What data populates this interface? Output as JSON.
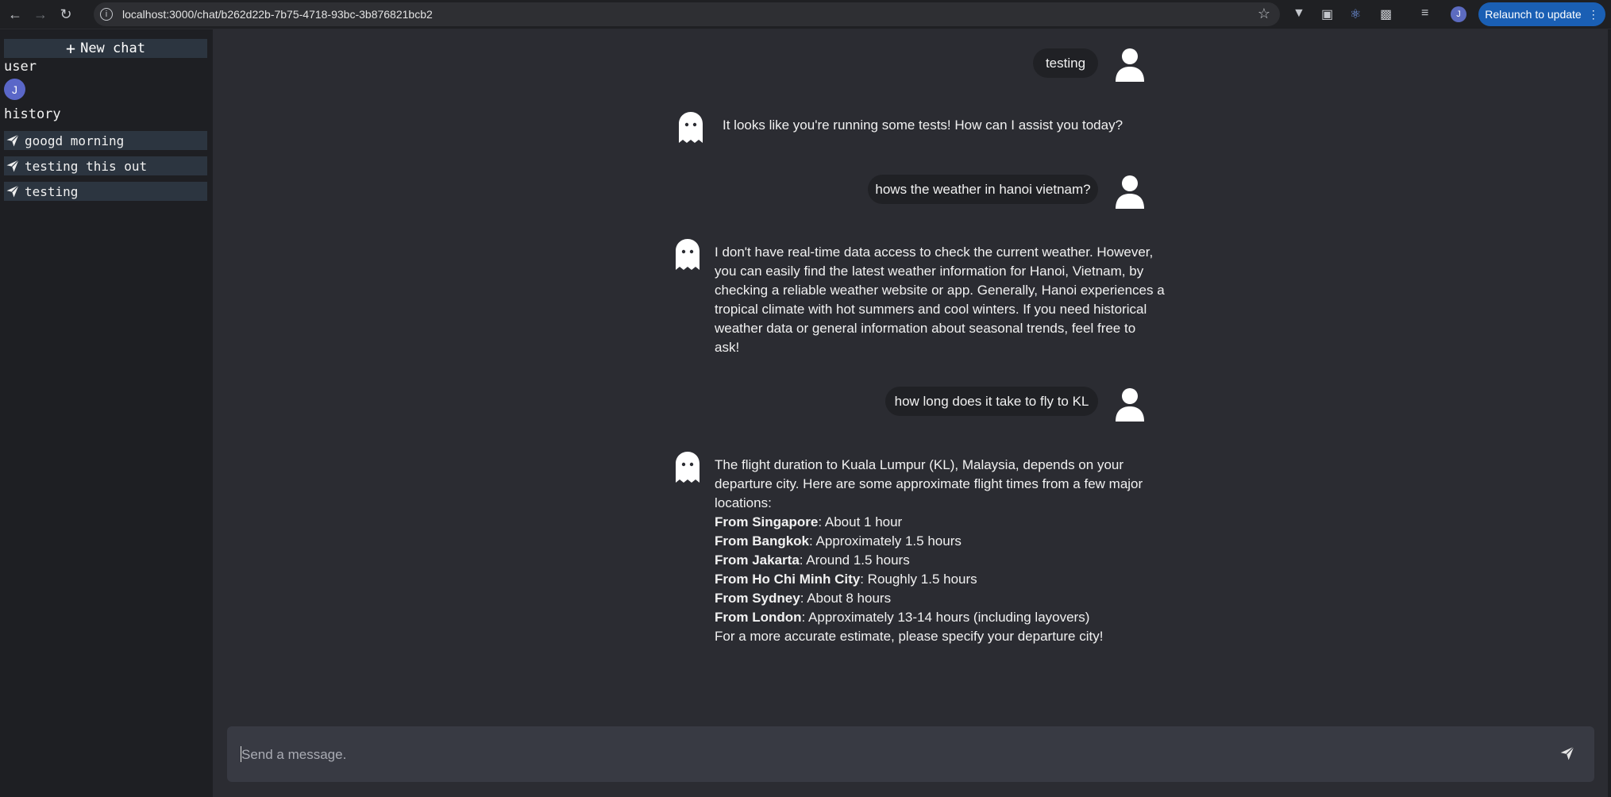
{
  "browser": {
    "url": "localhost:3000/chat/b262d22b-7b75-4718-93bc-3b876821bcb2",
    "profile_initial": "J",
    "relaunch_label": "Relaunch to update"
  },
  "sidebar": {
    "new_chat_label": "New chat",
    "user_label": "user",
    "avatar_initial": "J",
    "history_label": "history",
    "history_items": [
      {
        "label": "googd morning"
      },
      {
        "label": "testing this out"
      },
      {
        "label": "testing"
      }
    ]
  },
  "chat": {
    "messages": [
      {
        "role": "user",
        "text": "testing"
      },
      {
        "role": "bot",
        "text": "It looks like you're running some tests! How can I assist you today?"
      },
      {
        "role": "user",
        "text": "hows the weather in hanoi vietnam?"
      },
      {
        "role": "bot",
        "lines": [
          "I don't have real-time data access to check the current weather. However,",
          "you can easily find the latest weather information for Hanoi, Vietnam, by",
          "checking a reliable weather website or app. Generally, Hanoi experiences a",
          "tropical climate with hot summers and cool winters. If you need historical",
          "weather data or general information about seasonal trends, feel free to",
          "ask!"
        ]
      },
      {
        "role": "user",
        "text": "how long does it take to fly to KL"
      },
      {
        "role": "bot",
        "intro": [
          "The flight duration to Kuala Lumpur (KL), Malaysia, depends on your",
          "departure city. Here are some approximate flight times from a few major",
          "locations:"
        ],
        "items": [
          {
            "city": "From Singapore",
            "time": ": About 1 hour"
          },
          {
            "city": "From Bangkok",
            "time": ": Approximately 1.5 hours"
          },
          {
            "city": "From Jakarta",
            "time": ": Around 1.5 hours"
          },
          {
            "city": "From Ho Chi Minh City",
            "time": ": Roughly 1.5 hours"
          },
          {
            "city": "From Sydney",
            "time": ": About 8 hours"
          },
          {
            "city": "From London",
            "time": ": Approximately 13-14 hours (including layovers)"
          }
        ],
        "outro": "For a more accurate estimate, please specify your departure city!"
      }
    ]
  },
  "input": {
    "placeholder": "Send a message."
  },
  "colors": {
    "sidebar_bg": "#1e1f23",
    "chat_bg": "#2b2c32",
    "bubble_bg": "#202125",
    "history_item_bg": "#2c3540",
    "input_bg": "#383a43",
    "avatar": "#5a67c8",
    "relaunch": "#1a5fb4"
  }
}
